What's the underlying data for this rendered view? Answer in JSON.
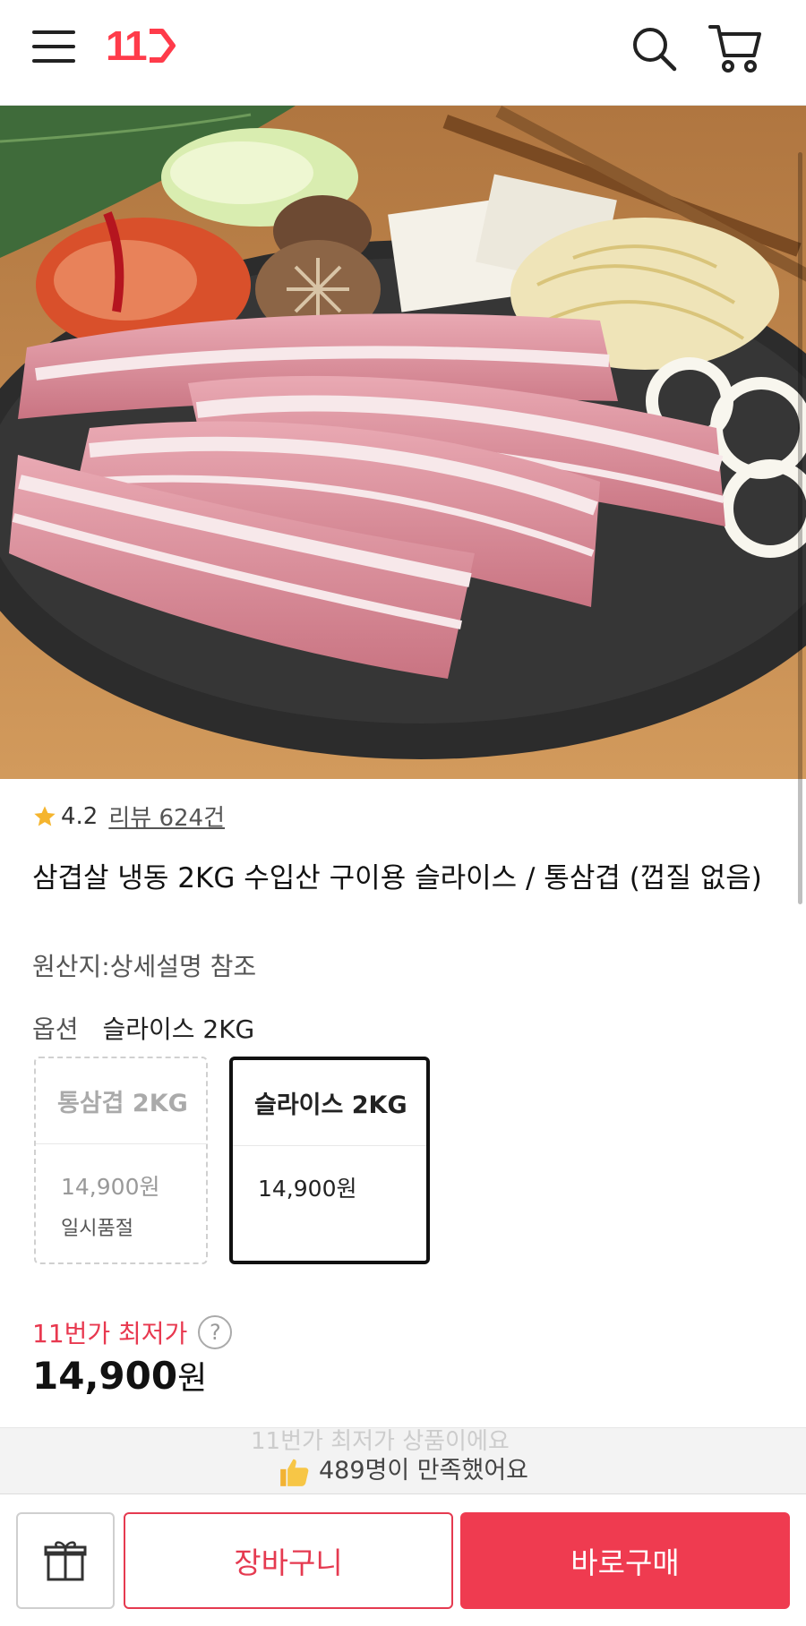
{
  "header": {
    "logo_text": "11",
    "menu_icon": "hamburger-menu-icon",
    "search_icon": "search-icon",
    "cart_icon": "cart-icon",
    "brand_color": "#ff3b4a"
  },
  "product": {
    "rating": "4.2",
    "review_label": "리뷰 624건",
    "title": "삼겹살 냉동 2KG 수입산 구이용 슬라이스 / 통삼겹 (껍질 없음)",
    "origin": "원산지:상세설명 참조",
    "option_label": "옵션",
    "option_selected": "슬라이스 2KG",
    "options": [
      {
        "name": "통삼겹 2KG",
        "price": "14,900원",
        "status": "일시품절",
        "available": false
      },
      {
        "name": "슬라이스 2KG",
        "price": "14,900원",
        "status": "",
        "available": true
      }
    ],
    "lowest_label": "11번가 최저가",
    "help_icon": "question-icon",
    "price_num": "14,900",
    "price_unit": "원"
  },
  "bottom": {
    "ghost_text": "11번가 최저가 상품이에요",
    "satisfied": "489명이 만족했어요",
    "gift_icon": "gift-icon",
    "cart_add_label": "장바구니",
    "buy_label": "바로구매",
    "accent_color": "#ef3b50"
  }
}
